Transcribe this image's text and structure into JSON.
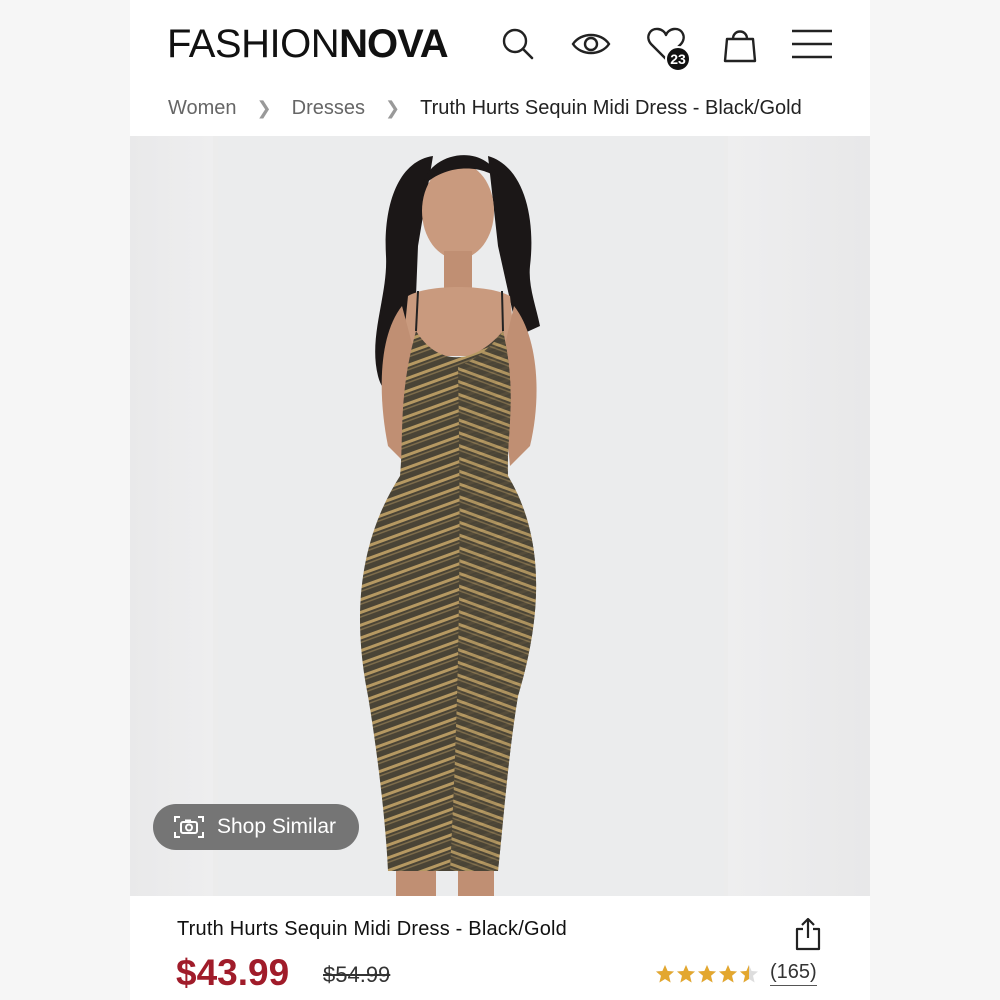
{
  "header": {
    "logo_thin": "FASHION",
    "logo_bold": "NOVA",
    "wishlist_count": "23"
  },
  "breadcrumb": {
    "items": [
      "Women",
      "Dresses",
      "Truth Hurts Sequin Midi Dress - Black/Gold"
    ]
  },
  "gallery": {
    "shop_similar_label": "Shop Similar"
  },
  "product": {
    "title": "Truth Hurts Sequin Midi Dress - Black/Gold",
    "price": "$43.99",
    "original_price": "$54.99",
    "rating": 4.5,
    "review_count": "(165)"
  },
  "icons": {
    "search": "search-icon",
    "view": "eye-icon",
    "wishlist": "heart-icon",
    "bag": "shopping-bag-icon",
    "menu": "hamburger-menu-icon",
    "camera": "camera-icon",
    "share": "share-icon",
    "star": "star-icon"
  },
  "colors": {
    "price": "#a01c2a",
    "star": "#e3a72f",
    "dress": "#4a4436",
    "sequin": "#c9a86a"
  }
}
